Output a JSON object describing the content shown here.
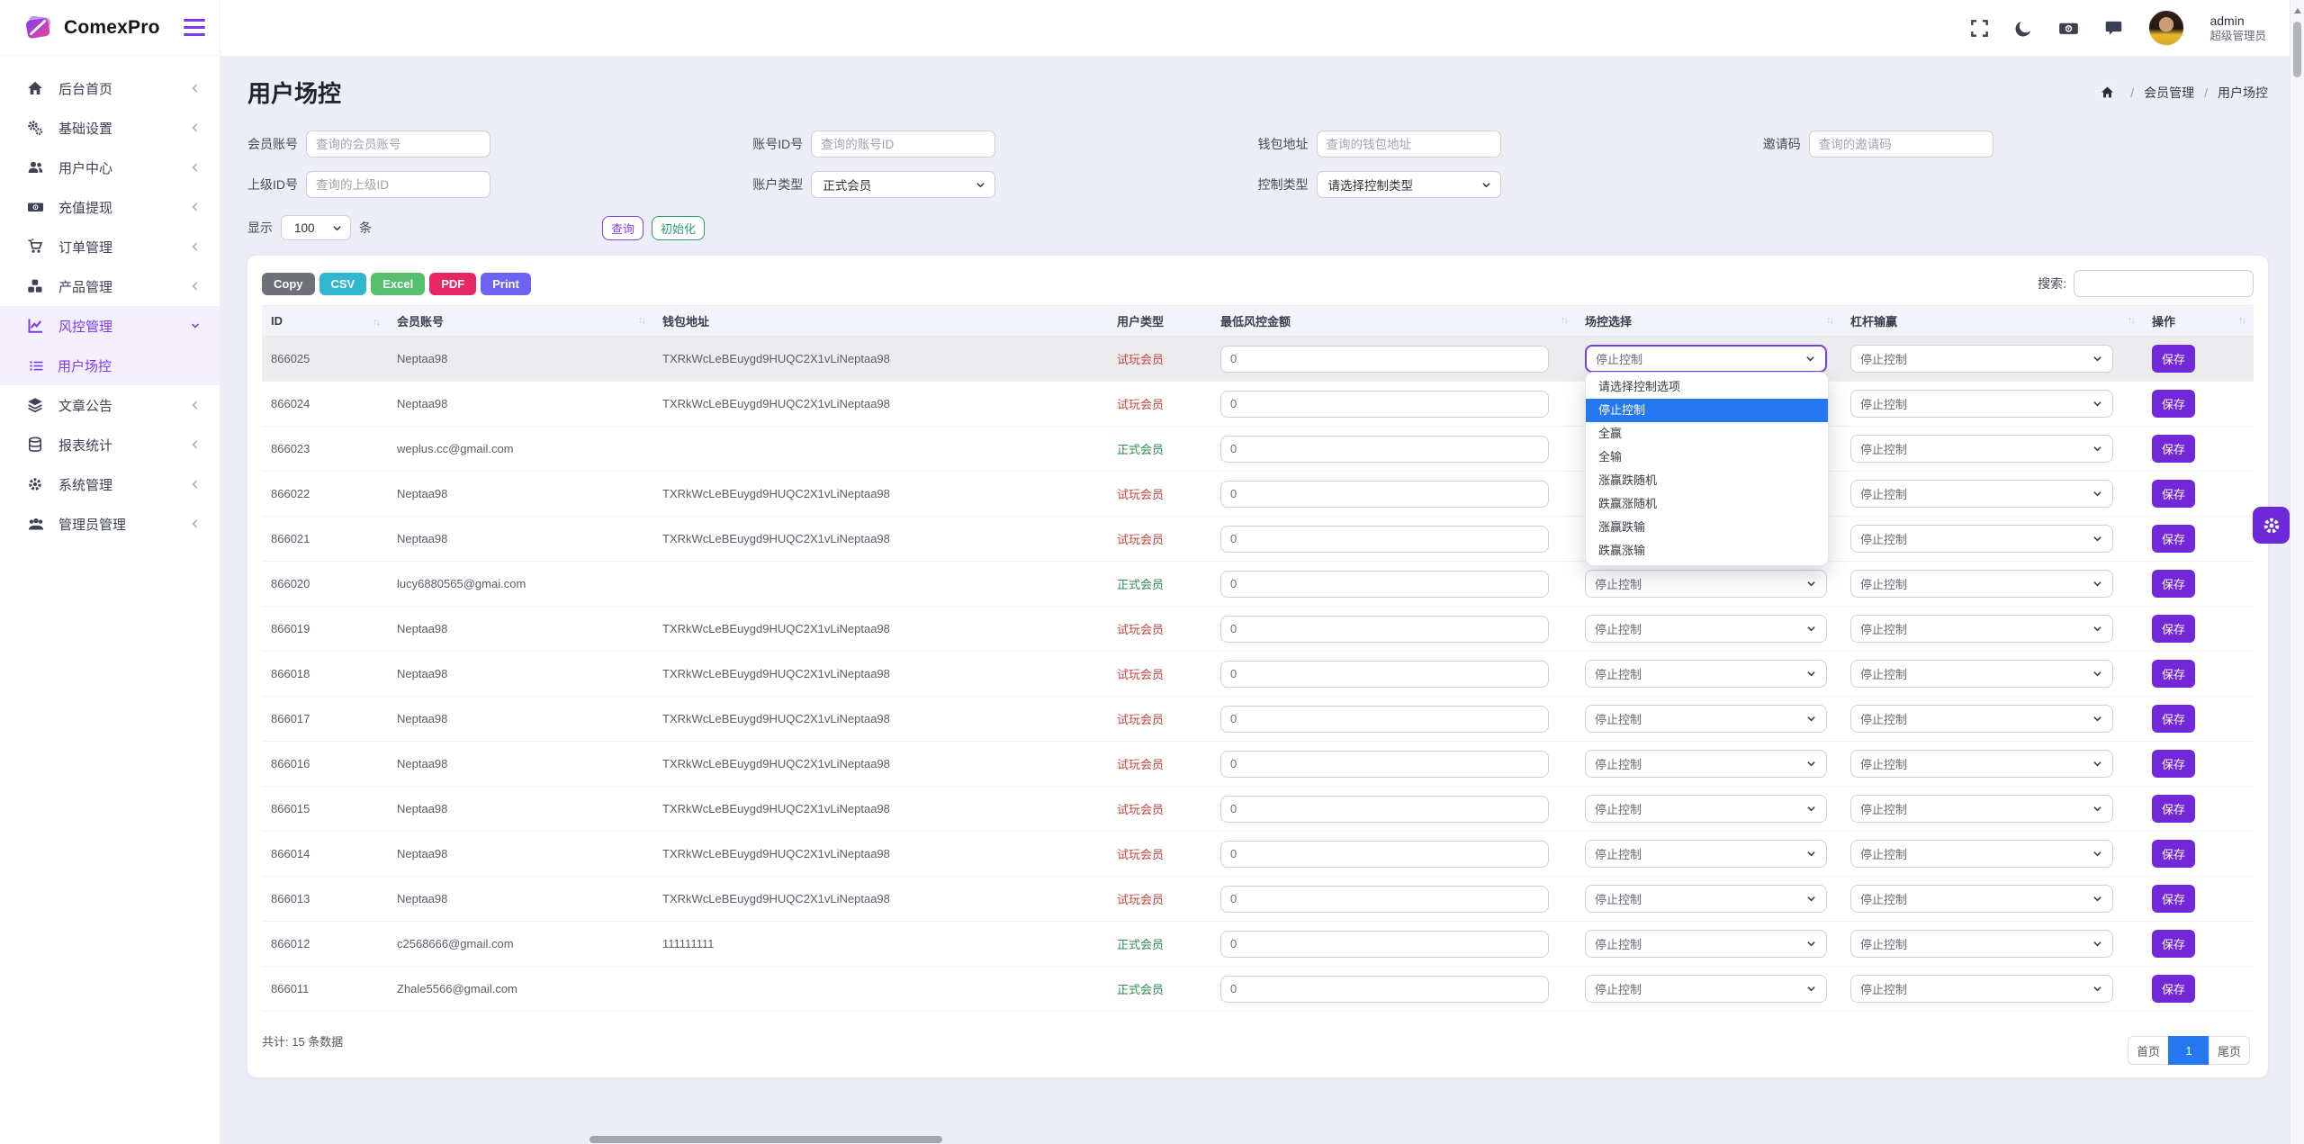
{
  "brand": {
    "name": "ComexPro"
  },
  "topbar": {
    "icons": [
      "fullscreen-icon",
      "dark-mode-icon",
      "cashier-icon",
      "chat-icon"
    ],
    "user": {
      "name": "admin",
      "role": "超级管理员"
    }
  },
  "sidebar": {
    "items": [
      {
        "label": "后台首页",
        "icon": "home-icon"
      },
      {
        "label": "基础设置",
        "icon": "gears-icon"
      },
      {
        "label": "用户中心",
        "icon": "users-icon"
      },
      {
        "label": "充值提现",
        "icon": "money-icon"
      },
      {
        "label": "订单管理",
        "icon": "cart-icon"
      },
      {
        "label": "产品管理",
        "icon": "boxes-icon"
      },
      {
        "label": "风控管理",
        "icon": "chart-icon",
        "active": true,
        "expanded": true,
        "children": [
          {
            "label": "用户场控",
            "icon": "list-icon",
            "active": true
          }
        ]
      },
      {
        "label": "文章公告",
        "icon": "layers-icon"
      },
      {
        "label": "报表统计",
        "icon": "coins-icon"
      },
      {
        "label": "系统管理",
        "icon": "gear-icon"
      },
      {
        "label": "管理员管理",
        "icon": "group-icon"
      }
    ]
  },
  "page": {
    "title": "用户场控",
    "breadcrumb": {
      "items": [
        "会员管理",
        "用户场控"
      ]
    }
  },
  "filters": {
    "member_account": {
      "label": "会员账号",
      "placeholder": "查询的会员账号",
      "value": ""
    },
    "account_id": {
      "label": "账号ID号",
      "placeholder": "查询的账号ID",
      "value": ""
    },
    "wallet_address": {
      "label": "钱包地址",
      "placeholder": "查询的钱包地址",
      "value": ""
    },
    "invite_code": {
      "label": "邀请码",
      "placeholder": "查询的邀请码",
      "value": ""
    },
    "parent_id": {
      "label": "上级ID号",
      "placeholder": "查询的上级ID",
      "value": ""
    },
    "account_type": {
      "label": "账户类型",
      "value": "正式会员"
    },
    "control_type": {
      "label": "控制类型",
      "value": "请选择控制类型"
    }
  },
  "toolbar": {
    "show_label": "显示",
    "page_size": "100",
    "unit_label": "条",
    "query_button": "查询",
    "reset_button": "初始化"
  },
  "export_buttons": [
    {
      "label": "Copy",
      "color": "#6e7178"
    },
    {
      "label": "CSV",
      "color": "#31b7cd"
    },
    {
      "label": "Excel",
      "color": "#55bf6e"
    },
    {
      "label": "PDF",
      "color": "#e72764"
    },
    {
      "label": "Print",
      "color": "#6e62f0"
    }
  ],
  "search": {
    "label": "搜索:",
    "value": ""
  },
  "table": {
    "columns": [
      {
        "label": "ID",
        "sortable": true
      },
      {
        "label": "会员账号",
        "sortable": true
      },
      {
        "label": "钱包地址",
        "sortable": false
      },
      {
        "label": "用户类型",
        "sortable": false
      },
      {
        "label": "最低风控金额",
        "sortable": true
      },
      {
        "label": "场控选择",
        "sortable": true
      },
      {
        "label": "杠杆输赢",
        "sortable": true
      },
      {
        "label": "操作",
        "sortable": true
      }
    ],
    "save_label": "保存",
    "rows": [
      {
        "id": "866025",
        "account": "Neptaa98",
        "wallet": "TXRkWcLeBEuygd9HUQC2X1vLiNeptaa98",
        "type": "试玩会员",
        "type_key": "trial",
        "amount": "0",
        "control": "停止控制",
        "leverage": "停止控制",
        "highlighted": true,
        "control_focused": true
      },
      {
        "id": "866024",
        "account": "Neptaa98",
        "wallet": "TXRkWcLeBEuygd9HUQC2X1vLiNeptaa98",
        "type": "试玩会员",
        "type_key": "trial",
        "amount": "0",
        "control": "停止控制",
        "leverage": "停止控制"
      },
      {
        "id": "866023",
        "account": "weplus.cc@gmail.com",
        "wallet": "",
        "type": "正式会员",
        "type_key": "formal",
        "amount": "0",
        "control": "停止控制",
        "leverage": "停止控制"
      },
      {
        "id": "866022",
        "account": "Neptaa98",
        "wallet": "TXRkWcLeBEuygd9HUQC2X1vLiNeptaa98",
        "type": "试玩会员",
        "type_key": "trial",
        "amount": "0",
        "control": "停止控制",
        "leverage": "停止控制"
      },
      {
        "id": "866021",
        "account": "Neptaa98",
        "wallet": "TXRkWcLeBEuygd9HUQC2X1vLiNeptaa98",
        "type": "试玩会员",
        "type_key": "trial",
        "amount": "0",
        "control": "停止控制",
        "leverage": "停止控制"
      },
      {
        "id": "866020",
        "account": "lucy6880565@gmai.com",
        "wallet": "",
        "type": "正式会员",
        "type_key": "formal",
        "amount": "0",
        "control": "停止控制",
        "leverage": "停止控制"
      },
      {
        "id": "866019",
        "account": "Neptaa98",
        "wallet": "TXRkWcLeBEuygd9HUQC2X1vLiNeptaa98",
        "type": "试玩会员",
        "type_key": "trial",
        "amount": "0",
        "control": "停止控制",
        "leverage": "停止控制"
      },
      {
        "id": "866018",
        "account": "Neptaa98",
        "wallet": "TXRkWcLeBEuygd9HUQC2X1vLiNeptaa98",
        "type": "试玩会员",
        "type_key": "trial",
        "amount": "0",
        "control": "停止控制",
        "leverage": "停止控制"
      },
      {
        "id": "866017",
        "account": "Neptaa98",
        "wallet": "TXRkWcLeBEuygd9HUQC2X1vLiNeptaa98",
        "type": "试玩会员",
        "type_key": "trial",
        "amount": "0",
        "control": "停止控制",
        "leverage": "停止控制"
      },
      {
        "id": "866016",
        "account": "Neptaa98",
        "wallet": "TXRkWcLeBEuygd9HUQC2X1vLiNeptaa98",
        "type": "试玩会员",
        "type_key": "trial",
        "amount": "0",
        "control": "停止控制",
        "leverage": "停止控制"
      },
      {
        "id": "866015",
        "account": "Neptaa98",
        "wallet": "TXRkWcLeBEuygd9HUQC2X1vLiNeptaa98",
        "type": "试玩会员",
        "type_key": "trial",
        "amount": "0",
        "control": "停止控制",
        "leverage": "停止控制"
      },
      {
        "id": "866014",
        "account": "Neptaa98",
        "wallet": "TXRkWcLeBEuygd9HUQC2X1vLiNeptaa98",
        "type": "试玩会员",
        "type_key": "trial",
        "amount": "0",
        "control": "停止控制",
        "leverage": "停止控制"
      },
      {
        "id": "866013",
        "account": "Neptaa98",
        "wallet": "TXRkWcLeBEuygd9HUQC2X1vLiNeptaa98",
        "type": "试玩会员",
        "type_key": "trial",
        "amount": "0",
        "control": "停止控制",
        "leverage": "停止控制"
      },
      {
        "id": "866012",
        "account": "c2568666@gmail.com",
        "wallet": "111111111",
        "type": "正式会员",
        "type_key": "formal",
        "amount": "0",
        "control": "停止控制",
        "leverage": "停止控制"
      },
      {
        "id": "866011",
        "account": "Zhale5566@gmail.com",
        "wallet": "",
        "type": "正式会员",
        "type_key": "formal",
        "amount": "0",
        "control": "停止控制",
        "leverage": "停止控制"
      }
    ]
  },
  "control_dropdown": {
    "open_row_id": "866025",
    "options": [
      "请选择控制选项",
      "停止控制",
      "全赢",
      "全输",
      "涨赢跌随机",
      "跌赢涨随机",
      "涨赢跌输",
      "跌赢涨输"
    ],
    "selected": "停止控制"
  },
  "footer": {
    "total_text": "共计: 15 条数据",
    "pagination": [
      {
        "label": "首页"
      },
      {
        "label": "1",
        "active": true
      },
      {
        "label": "尾页"
      }
    ]
  },
  "colors": {
    "accent_purple": "#7c3aed",
    "save_button_purple": "#7227d8",
    "selected_option_blue": "#2677f2",
    "active_page_blue": "#2677f2",
    "trial_member_red": "#c2453e",
    "formal_member_green": "#2f8a57"
  }
}
